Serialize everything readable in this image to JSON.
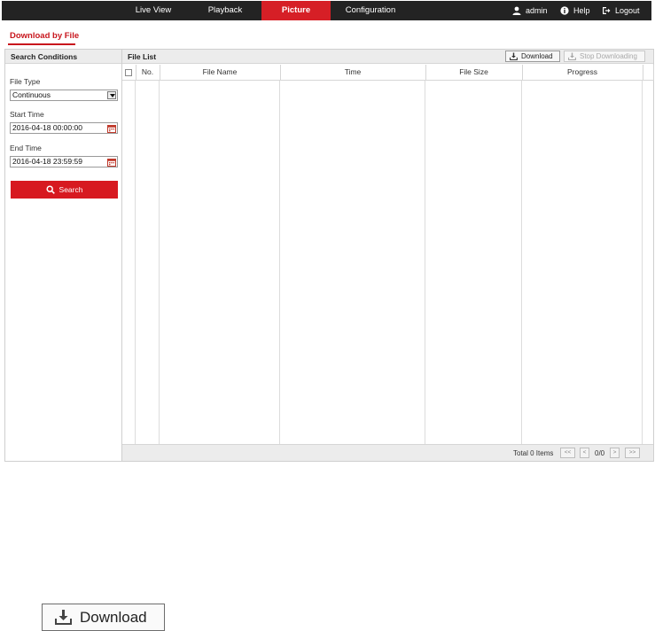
{
  "nav": {
    "tabs": [
      {
        "label": "Live View"
      },
      {
        "label": "Playback"
      },
      {
        "label": "Picture",
        "active": true
      },
      {
        "label": "Configuration"
      }
    ],
    "user": "admin",
    "help": "Help",
    "logout": "Logout"
  },
  "page_title": "Download by File",
  "search": {
    "header": "Search Conditions",
    "file_type_label": "File Type",
    "file_type_value": "Continuous",
    "start_time_label": "Start Time",
    "start_time_value": "2016-04-18 00:00:00",
    "end_time_label": "End Time",
    "end_time_value": "2016-04-18 23:59:59",
    "search_button": "Search"
  },
  "file_list": {
    "header": "File List",
    "download_button": "Download",
    "stop_button": "Stop Downloading",
    "columns": [
      "No.",
      "File Name",
      "Time",
      "File Size",
      "Progress"
    ],
    "rows": [],
    "total_label": "Total 0 Items",
    "pagination": {
      "first": "<<",
      "prev": "<",
      "page": "0/0",
      "next": ">",
      "last": ">>"
    }
  },
  "enlarged_download_label": "Download",
  "colors": {
    "topbar": "#232323",
    "accent": "#d61f26",
    "panel_header": "#ececec"
  }
}
